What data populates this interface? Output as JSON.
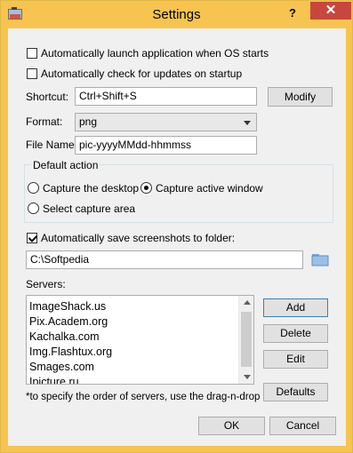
{
  "window": {
    "title": "Settings",
    "help_label": "?",
    "close_label": "✕"
  },
  "options": {
    "autolaunch_label": "Automatically launch application when OS starts",
    "autolaunch_checked": false,
    "autoupdate_label": "Automatically check for updates on startup",
    "autoupdate_checked": false
  },
  "shortcut": {
    "label": "Shortcut:",
    "value": "Ctrl+Shift+S",
    "modify_label": "Modify"
  },
  "format": {
    "label": "Format:",
    "selected": "png"
  },
  "filename": {
    "label": "File Name:",
    "value": "pic-yyyyMMdd-hhmmss"
  },
  "default_action": {
    "title": "Default action",
    "desktop_label": "Capture the desktop",
    "active_window_label": "Capture active window",
    "area_label": "Select capture area",
    "selected": "active_window"
  },
  "autosave": {
    "label": "Automatically save screenshots to folder:",
    "checked": true,
    "folder": "C:\\Softpedia"
  },
  "servers": {
    "label": "Servers:",
    "items": [
      "ImageShack.us",
      "Pix.Academ.org",
      "Kachalka.com",
      "Img.Flashtux.org",
      "Smages.com",
      "Ipicture.ru"
    ],
    "add_label": "Add",
    "delete_label": "Delete",
    "edit_label": "Edit",
    "defaults_label": "Defaults",
    "hint": "*to specify the order of servers, use the drag-n-drop"
  },
  "footer": {
    "ok_label": "OK",
    "cancel_label": "Cancel"
  },
  "colors": {
    "titlebar": "#f7c44f",
    "close_button": "#c7473d",
    "dialog_bg": "#f0f0f0"
  }
}
